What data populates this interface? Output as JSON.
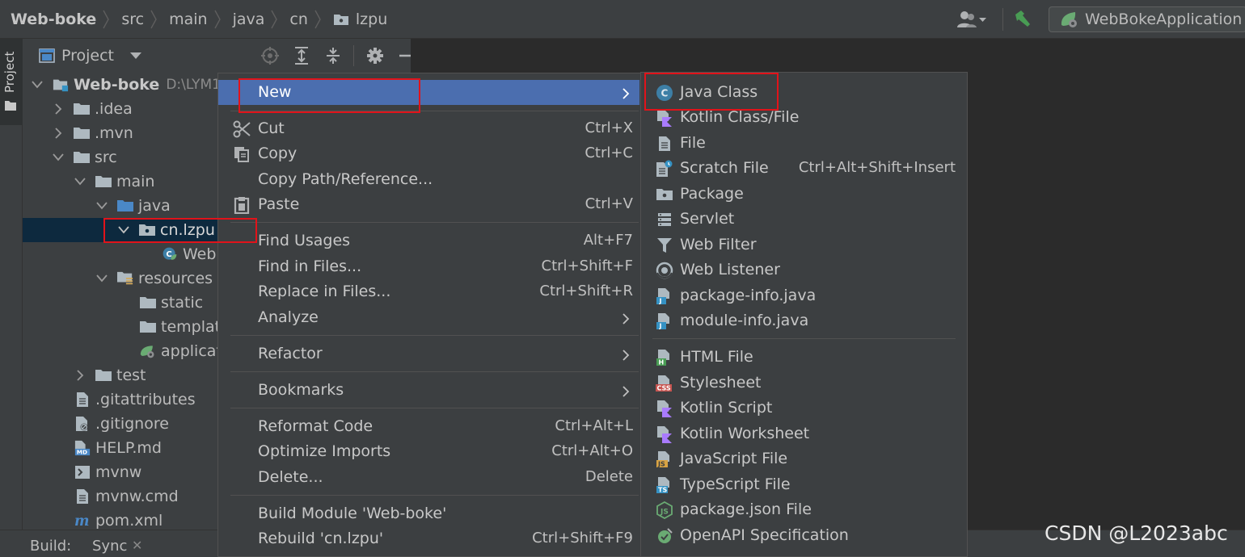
{
  "breadcrumb": [
    {
      "label": "Web-boke"
    },
    {
      "label": "src"
    },
    {
      "label": "main"
    },
    {
      "label": "java"
    },
    {
      "label": "cn"
    },
    {
      "label": "lzpu"
    }
  ],
  "toolbar": {
    "run_config": "WebBokeApplication"
  },
  "tool_stripe": {
    "project_tab": "Project"
  },
  "project_panel": {
    "title": "Project",
    "tree": [
      {
        "label": "Web-boke",
        "path": "D:\\LYM1"
      },
      {
        "label": ".idea"
      },
      {
        "label": ".mvn"
      },
      {
        "label": "src"
      },
      {
        "label": "main"
      },
      {
        "label": "java"
      },
      {
        "label": "cn.lzpu"
      },
      {
        "label": "Web"
      },
      {
        "label": "resources"
      },
      {
        "label": "static"
      },
      {
        "label": "templat"
      },
      {
        "label": "applicat"
      },
      {
        "label": "test"
      },
      {
        "label": ".gitattributes"
      },
      {
        "label": ".gitignore"
      },
      {
        "label": "HELP.md"
      },
      {
        "label": "mvnw"
      },
      {
        "label": "mvnw.cmd"
      },
      {
        "label": "pom.xml"
      }
    ]
  },
  "context_menu": {
    "items": [
      {
        "label": "New",
        "shortcut": ""
      },
      {
        "label": "Cut",
        "shortcut": "Ctrl+X"
      },
      {
        "label": "Copy",
        "shortcut": "Ctrl+C"
      },
      {
        "label": "Copy Path/Reference...",
        "shortcut": ""
      },
      {
        "label": "Paste",
        "shortcut": "Ctrl+V"
      },
      {
        "label": "Find Usages",
        "shortcut": "Alt+F7"
      },
      {
        "label": "Find in Files...",
        "shortcut": "Ctrl+Shift+F"
      },
      {
        "label": "Replace in Files...",
        "shortcut": "Ctrl+Shift+R"
      },
      {
        "label": "Analyze",
        "shortcut": ""
      },
      {
        "label": "Refactor",
        "shortcut": ""
      },
      {
        "label": "Bookmarks",
        "shortcut": ""
      },
      {
        "label": "Reformat Code",
        "shortcut": "Ctrl+Alt+L"
      },
      {
        "label": "Optimize Imports",
        "shortcut": "Ctrl+Alt+O"
      },
      {
        "label": "Delete...",
        "shortcut": "Delete"
      },
      {
        "label": "Build Module 'Web-boke'",
        "shortcut": ""
      },
      {
        "label": "Rebuild 'cn.lzpu'",
        "shortcut": "Ctrl+Shift+F9"
      }
    ]
  },
  "new_submenu": {
    "items": [
      {
        "label": "Java Class",
        "shortcut": ""
      },
      {
        "label": "Kotlin Class/File",
        "shortcut": ""
      },
      {
        "label": "File",
        "shortcut": ""
      },
      {
        "label": "Scratch File",
        "shortcut": "Ctrl+Alt+Shift+Insert"
      },
      {
        "label": "Package",
        "shortcut": ""
      },
      {
        "label": "Servlet",
        "shortcut": ""
      },
      {
        "label": "Web Filter",
        "shortcut": ""
      },
      {
        "label": "Web Listener",
        "shortcut": ""
      },
      {
        "label": "package-info.java",
        "shortcut": ""
      },
      {
        "label": "module-info.java",
        "shortcut": ""
      },
      {
        "label": "HTML File",
        "shortcut": ""
      },
      {
        "label": "Stylesheet",
        "shortcut": ""
      },
      {
        "label": "Kotlin Script",
        "shortcut": ""
      },
      {
        "label": "Kotlin Worksheet",
        "shortcut": ""
      },
      {
        "label": "JavaScript File",
        "shortcut": ""
      },
      {
        "label": "TypeScript File",
        "shortcut": ""
      },
      {
        "label": "package.json File",
        "shortcut": ""
      },
      {
        "label": "OpenAPI Specification",
        "shortcut": ""
      }
    ]
  },
  "bottom_bar": {
    "build_label": "Build:",
    "sync_tab": "Sync"
  },
  "watermark": "CSDN @L2023abc",
  "colors": {
    "menu_highlight": "#4b6eaf",
    "selection": "#0d293e",
    "annotation_red": "#e1131a",
    "folder_blue": "#4a88c7",
    "spring_green": "#6aab73"
  }
}
